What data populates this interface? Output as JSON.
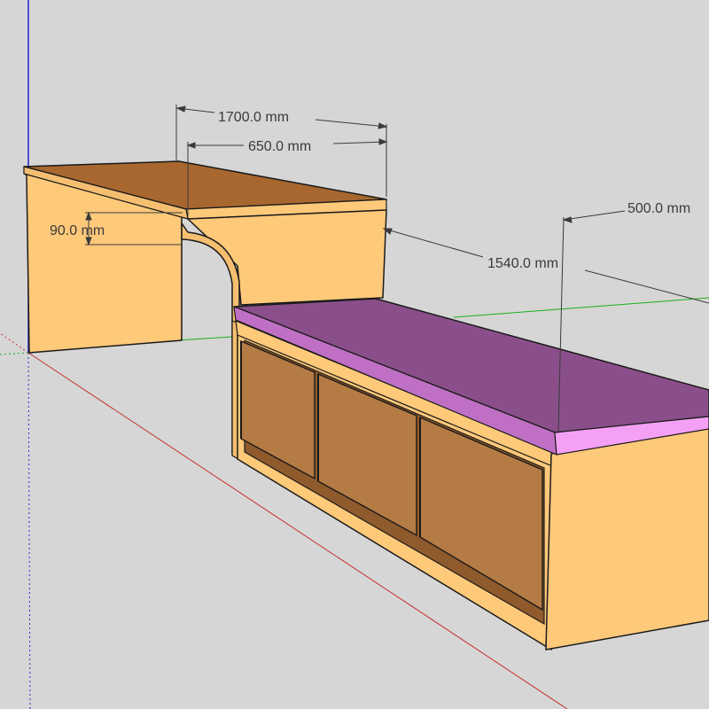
{
  "dimensions": {
    "desk_length": "1700.0 mm",
    "desk_depth": "650.0 mm",
    "top_thickness": "90.0 mm",
    "bench_length": "1540.0 mm",
    "bench_depth": "500.0 mm"
  },
  "colors": {
    "background": "#d6d6d6",
    "wood_light": "#ffc97a",
    "wood_side": "#f5be70",
    "wood_top": "#a8672f",
    "drawer_front": "#b57b44",
    "cushion_top": "#8a4f8a",
    "cushion_side": "#f4a0f4",
    "axis_red": "#c43030",
    "axis_green": "#18b018",
    "axis_blue": "#2020d0",
    "dimension_line": "#3a3a3a"
  }
}
